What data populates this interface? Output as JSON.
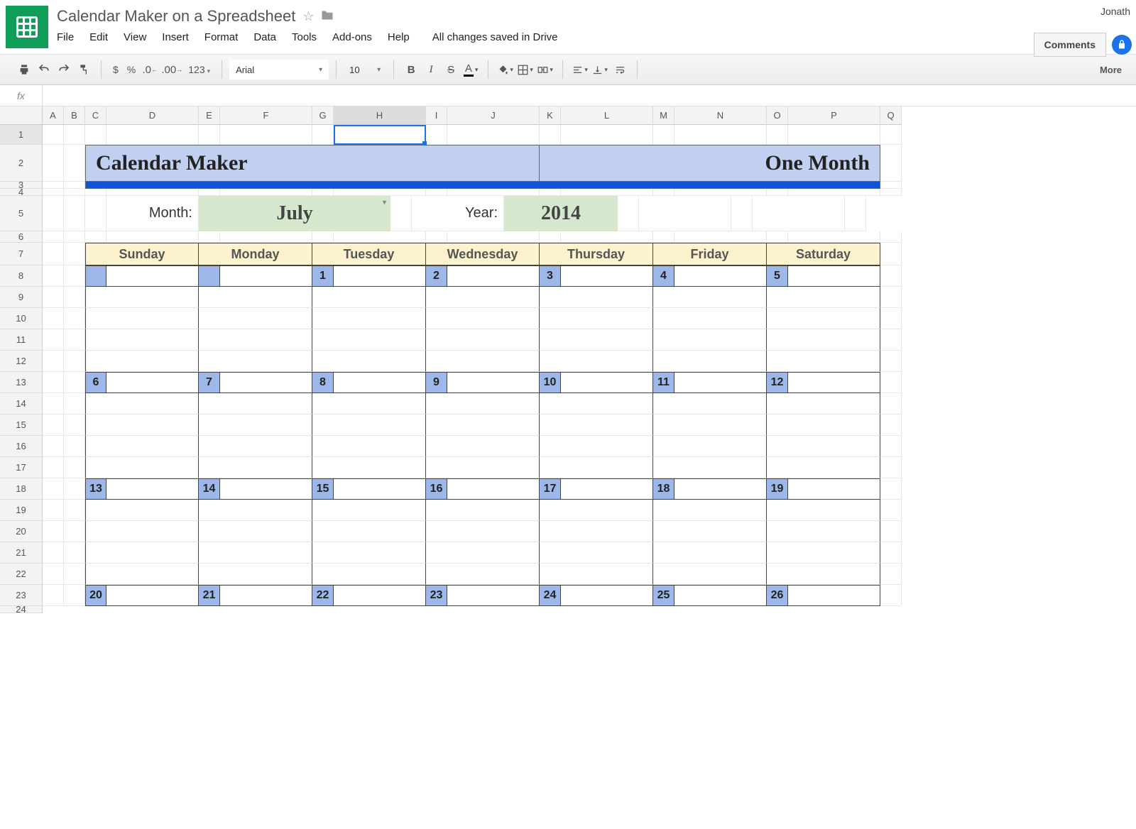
{
  "header": {
    "doc_title": "Calendar Maker on a Spreadsheet",
    "user_name": "Jonath",
    "comments_btn": "Comments",
    "save_status": "All changes saved in Drive",
    "menus": [
      "File",
      "Edit",
      "View",
      "Insert",
      "Format",
      "Data",
      "Tools",
      "Add-ons",
      "Help"
    ]
  },
  "toolbar": {
    "currency": "$",
    "percent": "%",
    "dec_dec": ".0",
    "inc_dec": ".00",
    "formats": "123",
    "font": "Arial",
    "size": "10",
    "bold": "B",
    "italic": "I",
    "strike": "S",
    "textA": "A",
    "more": "More"
  },
  "formula_bar": {
    "fx": "fx",
    "value": ""
  },
  "columns": [
    "A",
    "B",
    "C",
    "D",
    "E",
    "F",
    "G",
    "H",
    "I",
    "J",
    "K",
    "L",
    "M",
    "N",
    "O",
    "P",
    "Q"
  ],
  "rows": [
    "1",
    "2",
    "3",
    "4",
    "5",
    "6",
    "7",
    "8",
    "9",
    "10",
    "11",
    "12",
    "13",
    "14",
    "15",
    "16",
    "17",
    "18",
    "19",
    "20",
    "21",
    "22",
    "23",
    "24"
  ],
  "sheet": {
    "title_left": "Calendar Maker",
    "title_right": "One Month",
    "month_label": "Month:",
    "month_value": "July",
    "year_label": "Year:",
    "year_value": "2014",
    "day_headers": [
      "Sunday",
      "Monday",
      "Tuesday",
      "Wednesday",
      "Thursday",
      "Friday",
      "Saturday"
    ],
    "weeks": [
      [
        "",
        "",
        "1",
        "2",
        "3",
        "4",
        "5"
      ],
      [
        "6",
        "7",
        "8",
        "9",
        "10",
        "11",
        "12"
      ],
      [
        "13",
        "14",
        "15",
        "16",
        "17",
        "18",
        "19"
      ],
      [
        "20",
        "21",
        "22",
        "23",
        "24",
        "25",
        "26"
      ]
    ]
  },
  "active_cell": "H1"
}
